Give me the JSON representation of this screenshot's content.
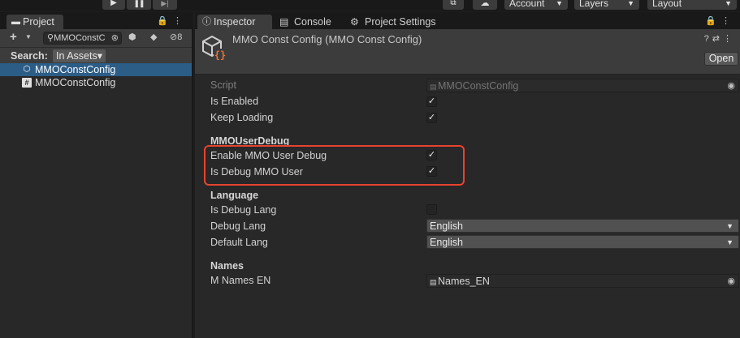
{
  "toolbar": {
    "play": "▶",
    "pause": "❚❚",
    "step": "▶|",
    "account": "Account",
    "layers": "Layers",
    "layout": "Layout"
  },
  "project": {
    "tab_label": "Project",
    "search_value": "MMOConstC",
    "hidden_count": "8",
    "search_label": "Search:",
    "scope": "In Assets",
    "items": [
      {
        "label": "MMOConstConfig",
        "icon": "scriptable-object-icon",
        "selected": true
      },
      {
        "label": "MMOConstConfig",
        "icon": "csharp-script-icon",
        "selected": false
      }
    ]
  },
  "inspector": {
    "tabs": [
      {
        "label": "Inspector",
        "icon": "info-icon"
      },
      {
        "label": "Console",
        "icon": "console-icon"
      },
      {
        "label": "Project Settings",
        "icon": "gear-icon"
      }
    ],
    "title": "MMO Const Config (MMO Const Config)",
    "open_label": "Open",
    "script_label": "Script",
    "script_value": "MMOConstConfig",
    "fields": {
      "is_enabled": {
        "label": "Is Enabled",
        "checked": true
      },
      "keep_loading": {
        "label": "Keep Loading",
        "checked": true
      },
      "enable_mmo_user_debug": {
        "label": "Enable MMO User Debug",
        "checked": true
      },
      "is_debug_mmo_user": {
        "label": "Is Debug MMO User",
        "checked": true
      },
      "is_debug_lang": {
        "label": "Is Debug Lang",
        "checked": false
      },
      "debug_lang": {
        "label": "Debug Lang",
        "value": "English"
      },
      "default_lang": {
        "label": "Default Lang",
        "value": "English"
      },
      "m_names_en": {
        "label": "M Names EN",
        "value": "Names_EN"
      }
    },
    "sections": {
      "user_debug": "MMOUserDebug",
      "language": "Language",
      "names": "Names"
    }
  },
  "colors": {
    "selection": "#2c5d87",
    "highlight_box": "#e8432e"
  }
}
